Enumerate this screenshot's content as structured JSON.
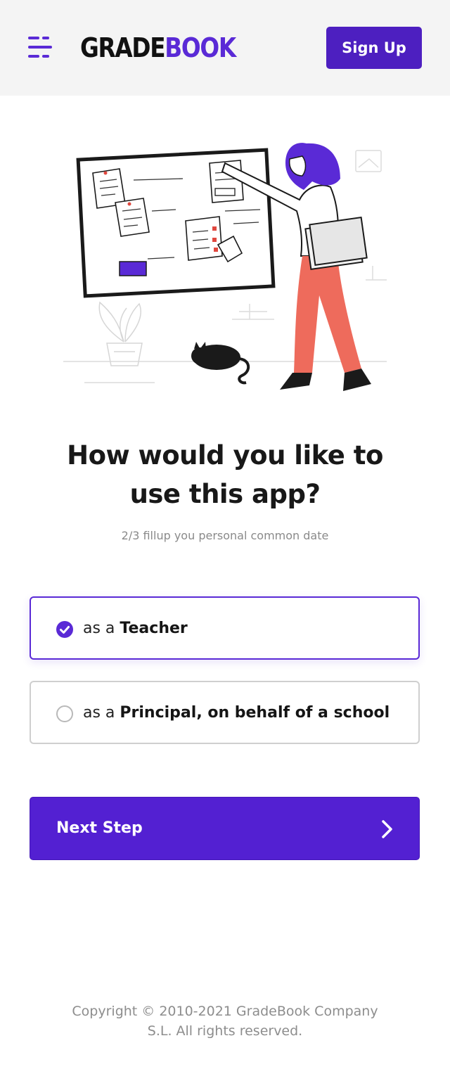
{
  "header": {
    "logo_part1": "GRADE",
    "logo_part2": "BOOK",
    "signup_label": "Sign Up",
    "menu_icon": "hamburger-menu-icon"
  },
  "main": {
    "title_line1": "How would you like to",
    "title_line2": "use this app?",
    "subtitle": "2/3 fillup you personal common date",
    "options": [
      {
        "prefix": "as a ",
        "label": "Teacher",
        "selected": true
      },
      {
        "prefix": "as a ",
        "label": "Principal, on behalf of a school",
        "selected": false
      }
    ],
    "next_label": "Next Step",
    "next_icon": "chevron-right-icon"
  },
  "footer": {
    "line1": "Copyright © 2010-2021 GradeBook Company",
    "line2": "S.L. All rights reserved."
  },
  "colors": {
    "accent": "#5a2ad6",
    "button": "#5320d2",
    "header_bg": "#f4f4f4",
    "pants": "#ee6b5c"
  }
}
